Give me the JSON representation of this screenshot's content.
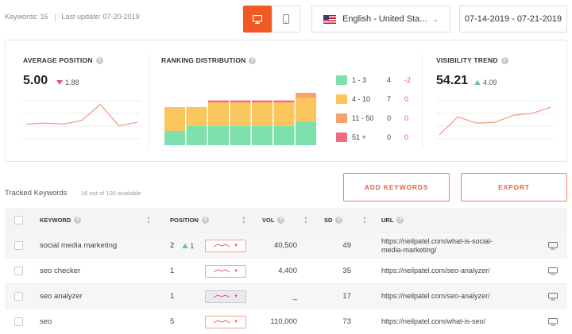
{
  "header": {
    "keywords_label": "Keywords: 16",
    "last_update": "Last update: 07-20-2019",
    "language": "English - United Sta...",
    "date_range": "07-14-2019 - 07-21-2019"
  },
  "average_position": {
    "title": "AVERAGE POSITION",
    "value": "5.00",
    "delta": "1.88",
    "delta_direction": "down",
    "trend": [
      2.2,
      2.3,
      2.2,
      2.6,
      4.4,
      2.0,
      2.4
    ]
  },
  "ranking_distribution": {
    "title": "RANKING DISTRIBUTION",
    "chart_data": {
      "type": "bar",
      "stacked": true,
      "categories": [
        "1",
        "2",
        "3",
        "4",
        "5",
        "6",
        "7"
      ],
      "series": [
        {
          "name": "1 - 3",
          "color": "#7ee0ad",
          "values": [
            3,
            4,
            4,
            4,
            4,
            4,
            5
          ]
        },
        {
          "name": "4 - 10",
          "color": "#fbc65e",
          "values": [
            5,
            4,
            5,
            5,
            5,
            5,
            5
          ]
        },
        {
          "name": "11 - 50",
          "color": "#f7a26a",
          "values": [
            0,
            0,
            0,
            0,
            0,
            0,
            1
          ]
        },
        {
          "name": "51 +",
          "color": "#ef6b7e",
          "values": [
            0,
            0,
            0.4,
            0.4,
            0.4,
            0.4,
            0
          ]
        }
      ]
    },
    "legend": [
      {
        "label": "1 - 3",
        "count": "4",
        "change": "-2",
        "color": "#7ee0ad"
      },
      {
        "label": "4 - 10",
        "count": "7",
        "change": "0",
        "color": "#fbc65e"
      },
      {
        "label": "11 - 50",
        "count": "0",
        "change": "0",
        "color": "#f7a26a"
      },
      {
        "label": "51 +",
        "count": "0",
        "change": "0",
        "color": "#ef6b7e"
      }
    ]
  },
  "visibility_trend": {
    "title": "VISIBILITY TREND",
    "value": "54.21",
    "delta": "4.09",
    "delta_direction": "up",
    "trend": [
      1.0,
      3.0,
      2.3,
      2.4,
      3.2,
      3.4,
      4.1
    ]
  },
  "tracked": {
    "title": "Tracked Keywords",
    "subtitle": "16 out of 100 available",
    "add_button": "ADD KEYWORDS",
    "export_button": "EXPORT"
  },
  "table": {
    "headers": {
      "keyword": "KEYWORD",
      "position": "POSITION",
      "vol": "VOL",
      "sd": "SD",
      "url": "URL"
    },
    "rows": [
      {
        "keyword": "social media marketing",
        "position": "2",
        "pos_change": "1",
        "vol": "40,500",
        "sd": "49",
        "url_1": "https://neilpatel.com/what-is-social-",
        "url_2": "media-marketing/"
      },
      {
        "keyword": "seo checker",
        "position": "1",
        "pos_change": "",
        "vol": "4,400",
        "sd": "35",
        "url_1": "https://neilpatel.com/seo-analyzer/",
        "url_2": ""
      },
      {
        "keyword": "seo analyzer",
        "position": "1",
        "pos_change": "",
        "vol": "_",
        "sd": "17",
        "url_1": "https://neilpatel.com/seo-analyzer/",
        "url_2": ""
      },
      {
        "keyword": "seo",
        "position": "5",
        "pos_change": "",
        "vol": "110,000",
        "sd": "73",
        "url_1": "https://neilpatel.com/what-is-seo/",
        "url_2": ""
      }
    ]
  },
  "colors": {
    "accent": "#f15a24",
    "line": "#f2a08a",
    "down": "#e8556d",
    "up": "#5ec4b6"
  }
}
